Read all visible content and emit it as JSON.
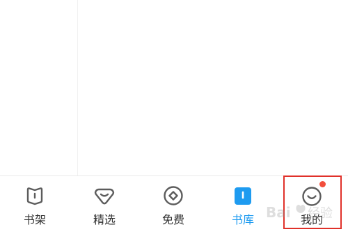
{
  "colors": {
    "active": "#1e9bf0",
    "inactive_icon": "#5c5c5c",
    "label": "#333333",
    "badge": "#f24e3c",
    "highlight": "#e0312a"
  },
  "tabs": [
    {
      "label": "书架",
      "icon": "bookshelf-icon",
      "active": false
    },
    {
      "label": "精选",
      "icon": "featured-icon",
      "active": false
    },
    {
      "label": "免费",
      "icon": "free-icon",
      "active": false
    },
    {
      "label": "书库",
      "icon": "library-icon",
      "active": true
    },
    {
      "label": "我的",
      "icon": "smiley-face-icon",
      "active": false,
      "badge": "red-dot"
    }
  ]
}
